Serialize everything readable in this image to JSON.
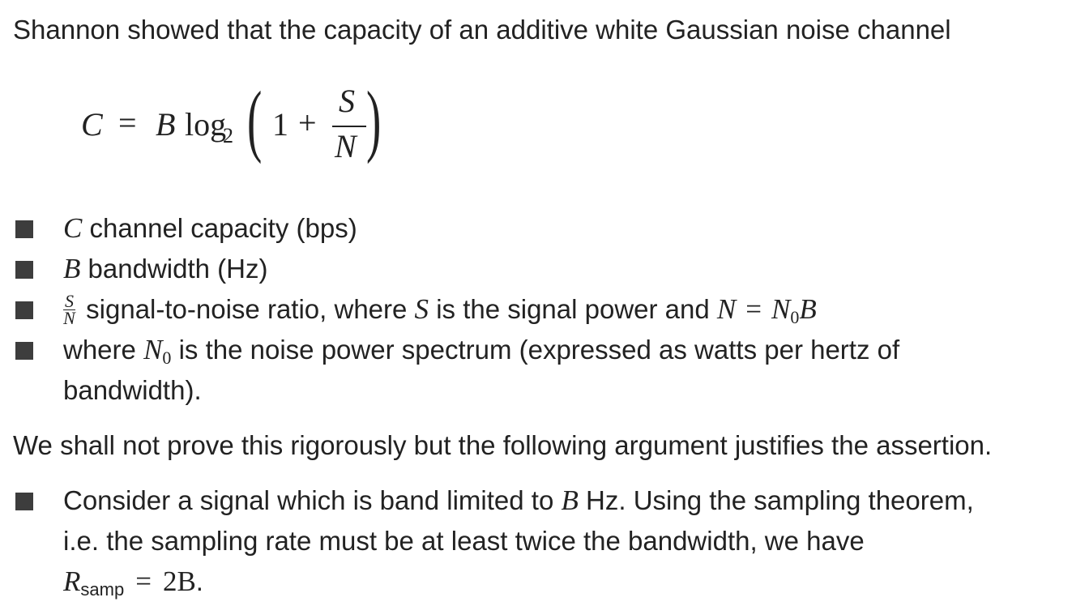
{
  "intro": {
    "text": "Shannon showed that the capacity of an additive white Gaussian noise channel"
  },
  "equation": {
    "lhs": "C",
    "equals": "=",
    "bandwidth": "B",
    "log": "log",
    "log_base": "2",
    "one": "1",
    "plus": "+",
    "numerator": "S",
    "denominator": "N"
  },
  "definitions": [
    {
      "symbol": "C",
      "text": " channel capacity (bps)"
    },
    {
      "symbol": "B",
      "text": " bandwidth (Hz)"
    },
    {
      "frac_num": "S",
      "frac_den": "N",
      "text_a": " signal-to-noise ratio, where ",
      "symbol_s": "S",
      "text_b": " is the signal power and ",
      "eq_lhs": "N",
      "eq_sign": "=",
      "eq_rhs_base": "N",
      "eq_rhs_sub": "0",
      "eq_rhs_tail": "B"
    },
    {
      "text_a": "where ",
      "symbol_base": "N",
      "symbol_sub": "0",
      "text_b": " is the noise power spectrum (expressed as watts per hertz of",
      "text_c": "bandwidth)."
    }
  ],
  "argument": {
    "text": "We shall not prove this rigorously but the following argument justifies the assertion."
  },
  "consider": {
    "text_a": "Consider a signal which is band limited to ",
    "symbol_b": "B",
    "text_b": " Hz. Using the sampling theorem,",
    "line2": "i.e. the sampling rate must be at least twice the bandwidth, we have",
    "rsamp_base": "R",
    "rsamp_sub": "samp",
    "rsamp_eq": "=",
    "rsamp_rhs": "2B",
    "rsamp_end": "."
  }
}
